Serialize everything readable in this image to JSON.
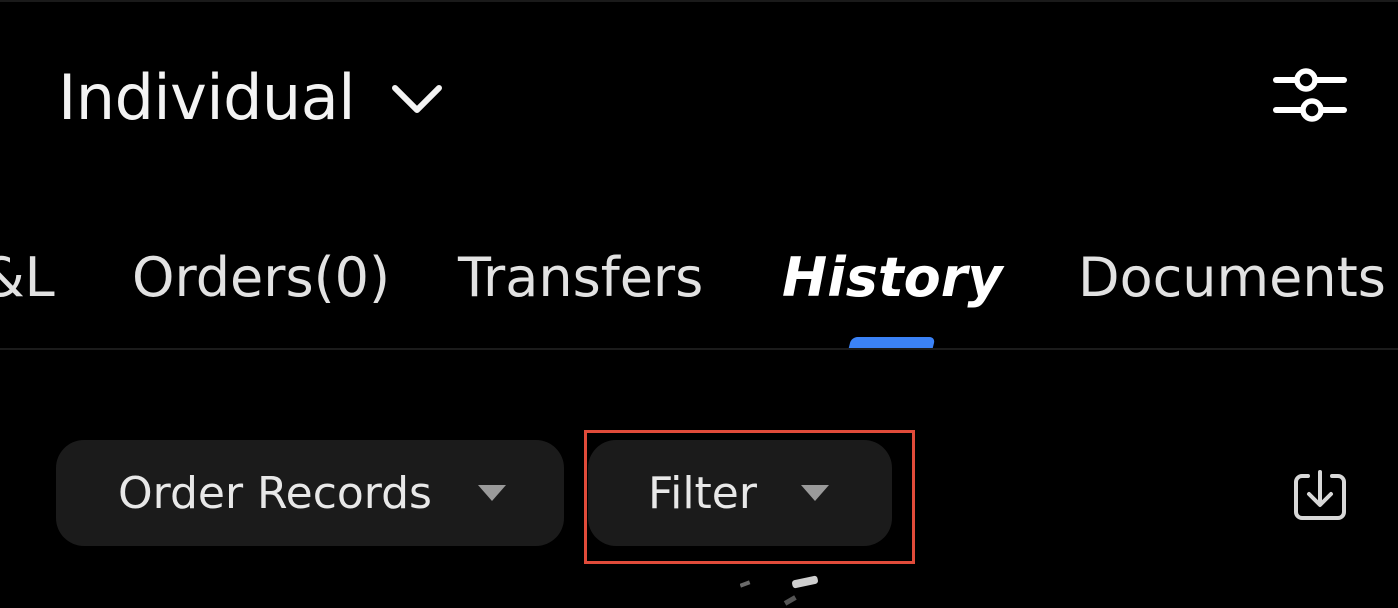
{
  "header": {
    "account_name": "Individual"
  },
  "tabs": [
    {
      "label": "P&L",
      "active": false
    },
    {
      "label": "Orders(0)",
      "active": false
    },
    {
      "label": "Transfers",
      "active": false
    },
    {
      "label": "History",
      "active": true
    },
    {
      "label": "Documents",
      "active": false
    }
  ],
  "toolbar": {
    "record_type": "Order Records",
    "filter": "Filter"
  },
  "icons": {
    "account_dropdown": "chevron-down-icon",
    "settings": "sliders-icon",
    "record_type_caret": "caret-down-icon",
    "filter_caret": "caret-down-icon",
    "download": "download-icon"
  },
  "colors": {
    "background": "#000000",
    "active_tab_indicator": "#3b82f6",
    "dropdown_background": "#1b1b1b",
    "highlight_outline": "#e04b3a"
  }
}
